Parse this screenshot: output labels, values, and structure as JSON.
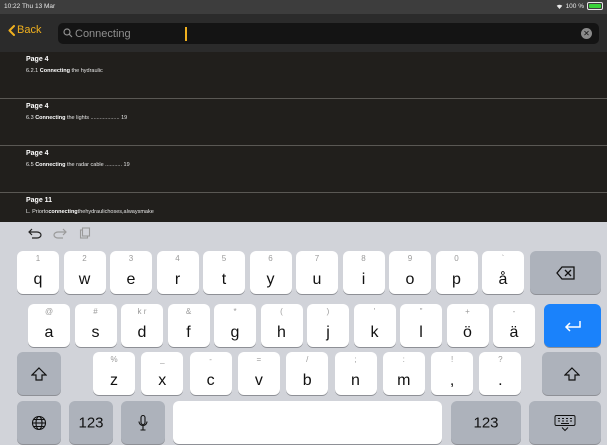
{
  "status": {
    "time_date": "10:22  Thu 13 Mar",
    "battery": "100 %"
  },
  "search": {
    "back_label": "Back",
    "query": "Connecting"
  },
  "results": [
    {
      "page": "Page 4",
      "prefix": "6.2.1 ",
      "match": "Connecting",
      "suffix": " the hydraulic"
    },
    {
      "page": "Page 4",
      "prefix": "6.3 ",
      "match": "Connecting",
      "suffix": " the lights ................... 19"
    },
    {
      "page": "Page 4",
      "prefix": "6.5 ",
      "match": "Connecting",
      "suffix": " the radar cable ........... 19"
    },
    {
      "page": "Page 11",
      "prefix": "L. Priorto",
      "match": "connecting",
      "suffix": "thehydraulichoses,alwaysmake"
    }
  ],
  "keyboard": {
    "toolbar_icons": [
      "undo-icon",
      "redo-icon",
      "paste-icon"
    ],
    "row1": [
      {
        "hint": "1",
        "key": "q"
      },
      {
        "hint": "2",
        "key": "w"
      },
      {
        "hint": "3",
        "key": "e"
      },
      {
        "hint": "4",
        "key": "r"
      },
      {
        "hint": "5",
        "key": "t"
      },
      {
        "hint": "6",
        "key": "y"
      },
      {
        "hint": "7",
        "key": "u"
      },
      {
        "hint": "8",
        "key": "i"
      },
      {
        "hint": "9",
        "key": "o"
      },
      {
        "hint": "0",
        "key": "p"
      },
      {
        "hint": "`",
        "key": "å"
      }
    ],
    "row2": [
      {
        "hint": "@",
        "key": "a"
      },
      {
        "hint": "#",
        "key": "s"
      },
      {
        "hint": "k r",
        "key": "d"
      },
      {
        "hint": "&",
        "key": "f"
      },
      {
        "hint": "*",
        "key": "g"
      },
      {
        "hint": "(",
        "key": "h"
      },
      {
        "hint": ")",
        "key": "j"
      },
      {
        "hint": "'",
        "key": "k"
      },
      {
        "hint": "\"",
        "key": "l"
      },
      {
        "hint": "+",
        "key": "ö"
      },
      {
        "hint": "-",
        "key": "ä"
      }
    ],
    "row3": [
      {
        "hint": "%",
        "key": "z"
      },
      {
        "hint": "_",
        "key": "x"
      },
      {
        "hint": "-",
        "key": "c"
      },
      {
        "hint": "=",
        "key": "v"
      },
      {
        "hint": "/",
        "key": "b"
      },
      {
        "hint": ";",
        "key": "n"
      },
      {
        "hint": ":",
        "key": "m"
      },
      {
        "hint": "!",
        "key": ","
      },
      {
        "hint": "?",
        "key": "."
      }
    ],
    "numbers_label": "123",
    "colors": {
      "accent": "#f0b01e",
      "return": "#1a82fb"
    }
  }
}
